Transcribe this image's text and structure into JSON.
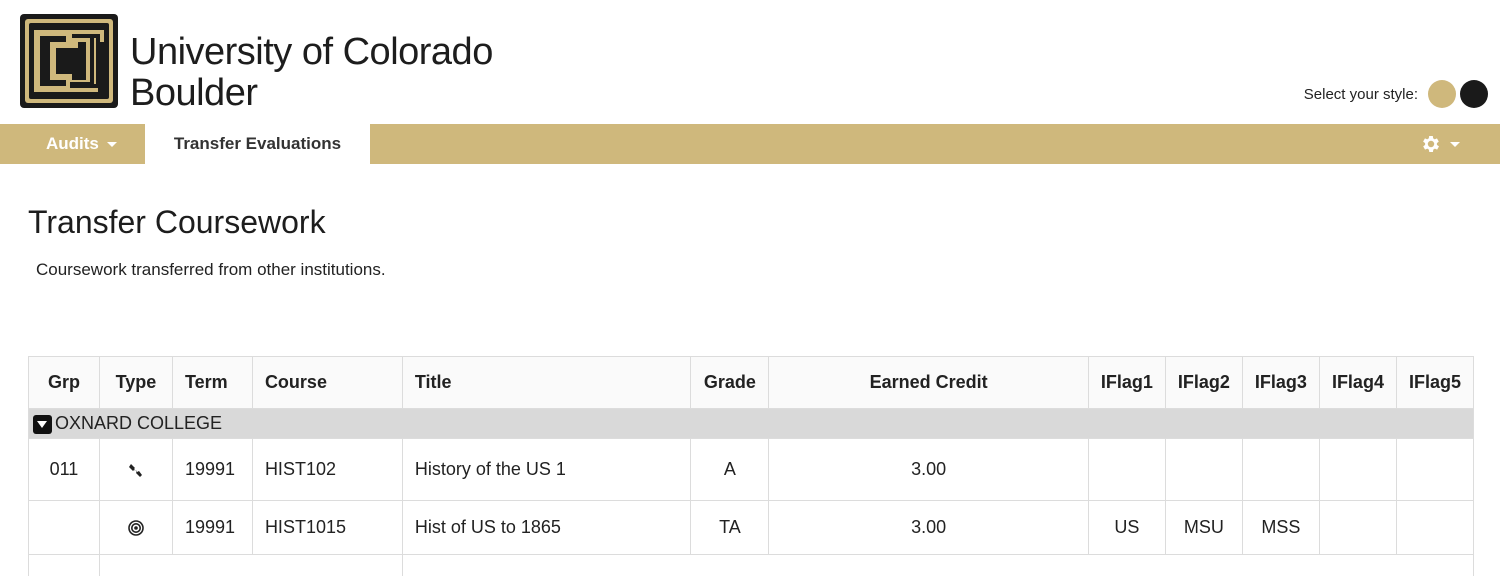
{
  "header": {
    "brand_line1": "University of Colorado",
    "brand_line2": "Boulder",
    "style_label": "Select your style:",
    "style_colors": [
      "#cfb87c",
      "#1a1a1a"
    ]
  },
  "nav": {
    "audits_label": "Audits",
    "transfer_label": "Transfer Evaluations",
    "gear_icon": "gear-icon"
  },
  "page": {
    "title": "Transfer Coursework",
    "description": "Coursework transferred from other institutions."
  },
  "table": {
    "headers": {
      "grp": "Grp",
      "type": "Type",
      "term": "Term",
      "course": "Course",
      "title": "Title",
      "grade": "Grade",
      "earned": "Earned Credit",
      "iflag1": "IFlag1",
      "iflag2": "IFlag2",
      "iflag3": "IFlag3",
      "iflag4": "IFlag4",
      "iflag5": "IFlag5"
    },
    "group_name": "OXNARD COLLEGE",
    "rows": [
      {
        "grp": "011",
        "type_icon": "wrench-icon",
        "term": "19991",
        "course": "HIST102",
        "title": "History of the US 1",
        "grade": "A",
        "earned": "3.00",
        "iflag1": "",
        "iflag2": "",
        "iflag3": "",
        "iflag4": "",
        "iflag5": ""
      },
      {
        "grp": "",
        "type_icon": "target-icon",
        "term": "19991",
        "course": "HIST1015",
        "title": "Hist of US to 1865",
        "grade": "TA",
        "earned": "3.00",
        "iflag1": "US",
        "iflag2": "MSU",
        "iflag3": "MSS",
        "iflag4": "",
        "iflag5": ""
      }
    ]
  },
  "colors": {
    "gold": "#cfb87c",
    "black": "#1a1a1a",
    "group_row": "#d9d9d9"
  }
}
